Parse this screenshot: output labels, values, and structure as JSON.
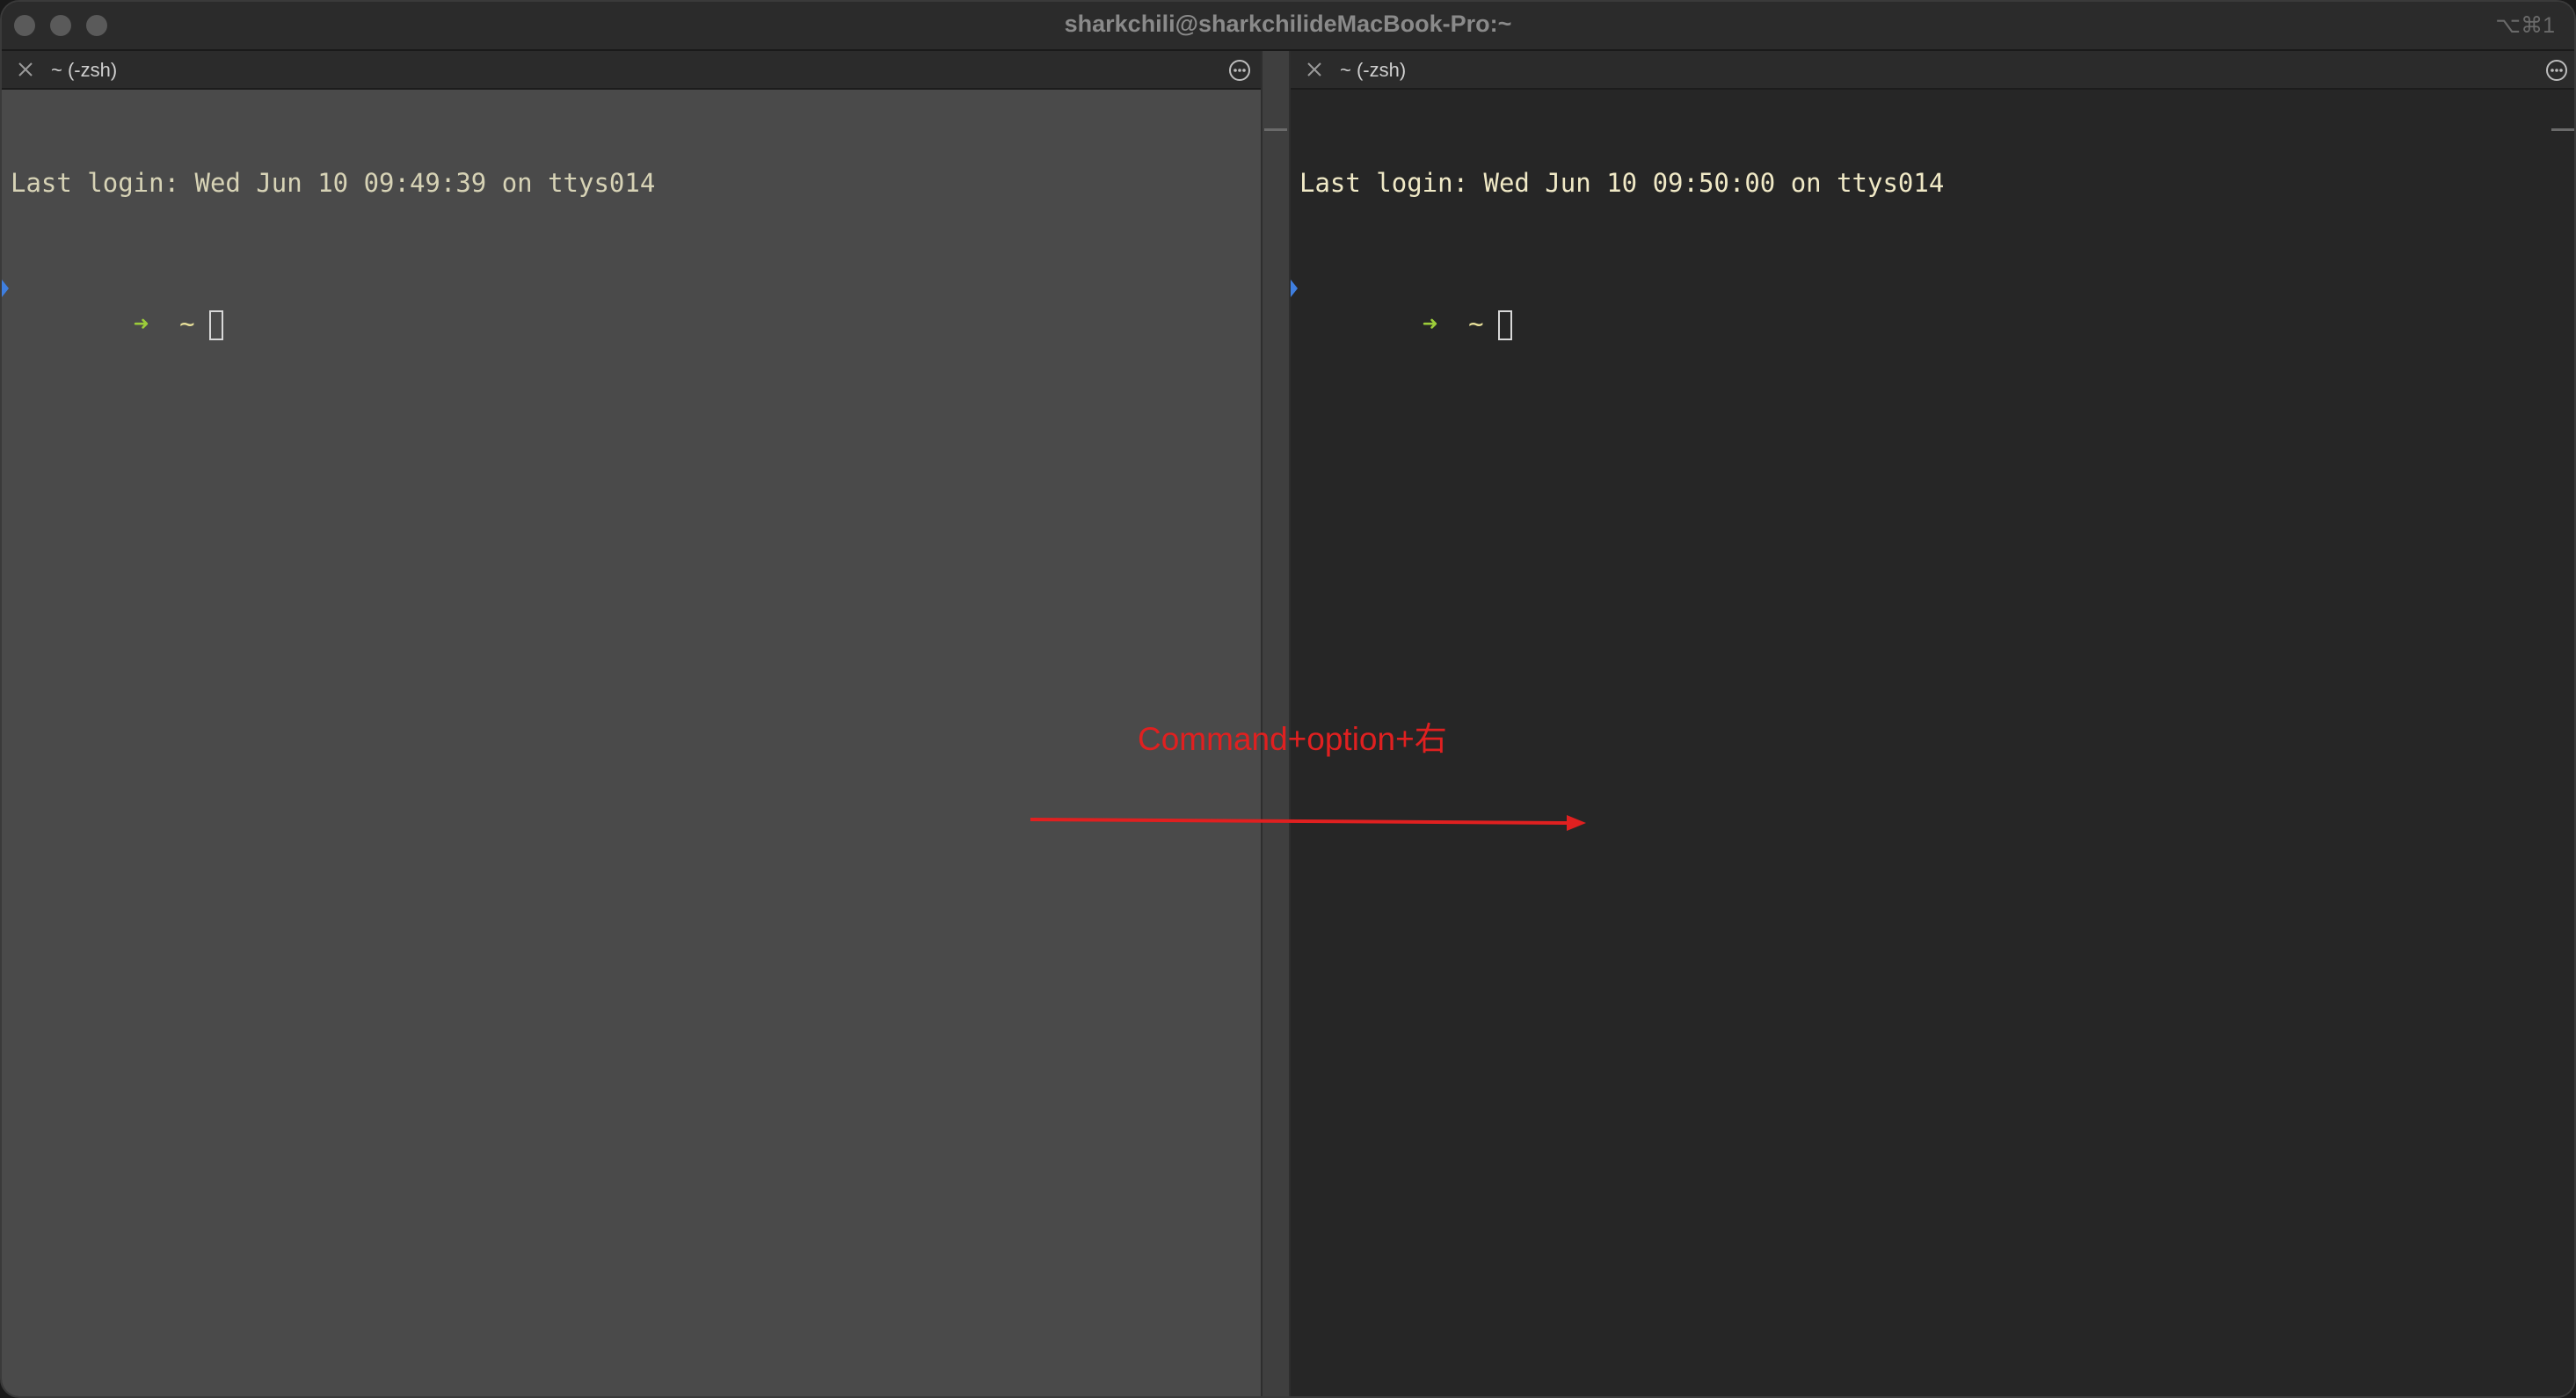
{
  "window": {
    "title": "sharkchili@sharkchilideMacBook-Pro:~",
    "shortcut": "⌥⌘1"
  },
  "panes": [
    {
      "tab_title": "~ (-zsh)",
      "login_line": "Last login: Wed Jun 10 09:49:39 on ttys014",
      "prompt_arrow": "➜",
      "prompt_path": "~"
    },
    {
      "tab_title": "~ (-zsh)",
      "login_line": "Last login: Wed Jun 10 09:50:00 on ttys014",
      "prompt_arrow": "➜",
      "prompt_path": "~"
    }
  ],
  "annotation": {
    "label": "Command+option+右",
    "color": "#e02020"
  },
  "colors": {
    "left_pane_bg": "#4a4a4a",
    "right_pane_bg": "#262626",
    "prompt_arrow": "#9ccc3a",
    "prompt_path": "#e8e09a"
  }
}
